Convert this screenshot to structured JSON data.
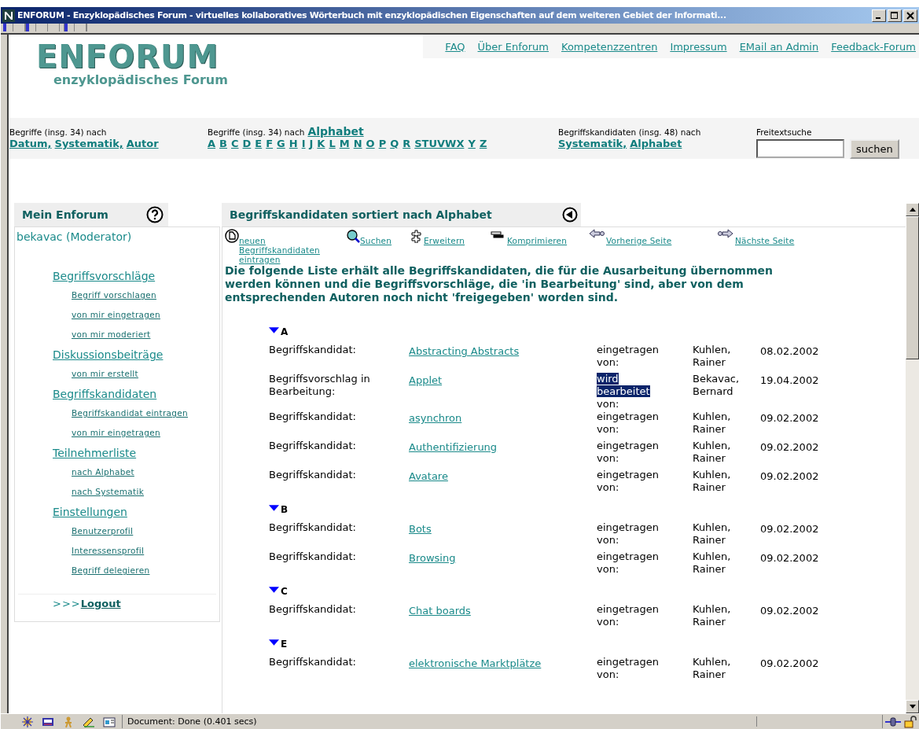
{
  "window": {
    "title": "ENFORUM - Enzyklopädisches Forum - virtuelles kollaboratives Wörterbuch mit enzyklopädischen Eigenschaften auf dem weiteren Gebiet der Informati..."
  },
  "logo": {
    "title": "ENFORUM",
    "subtitle": "enzyklopädisches Forum"
  },
  "top_links": [
    "FAQ",
    "Über Enforum",
    "Kompetenzzentren",
    "Impressum",
    "EMail an Admin",
    "Feedback-Forum"
  ],
  "nav": {
    "terms": {
      "label": "Begriffe (insg. 34)  nach",
      "links": [
        "Datum,",
        "Systematik,",
        "Autor"
      ]
    },
    "alphabet": {
      "label": "Begriffe (insg. 34)  nach",
      "title_link": "Alphabet",
      "letters": [
        "A",
        "B",
        "C",
        "D",
        "E",
        "F",
        "G",
        "H",
        "I",
        "J",
        "K",
        "L",
        "M",
        "N",
        "O",
        "P",
        "Q",
        "R",
        "STUVWX",
        "Y",
        "Z"
      ]
    },
    "candidates": {
      "label": "Begriffskandidaten (insg. 48) nach",
      "links": [
        "Systematik,",
        "Alphabet"
      ]
    },
    "search": {
      "label": "Freitextsuche",
      "button": "suchen"
    }
  },
  "sidebar": {
    "title": "Mein Enforum",
    "user": "bekavac (Moderator)",
    "sections": [
      {
        "label": "Begriffsvorschläge",
        "children": [
          "Begriff vorschlagen",
          "von mir eingetragen",
          "von mir moderiert"
        ]
      },
      {
        "label": "Diskussionsbeiträge",
        "children": [
          "von mir erstellt"
        ]
      },
      {
        "label": "Begriffskandidaten",
        "children": [
          "Begriffskandidat eintragen",
          "von mir eingetragen"
        ]
      },
      {
        "label": "Teilnehmerliste",
        "children": [
          "nach Alphabet",
          "nach Systematik"
        ]
      },
      {
        "label": "Einstellungen",
        "children": [
          "Benutzerprofil",
          "Interessensprofil",
          "Begriff delegieren"
        ]
      }
    ],
    "logout_prefix": ">>>",
    "logout": "Logout"
  },
  "main": {
    "title": "Begriffskandidaten  sortiert nach Alphabet",
    "actions": [
      {
        "kind": "new",
        "label": "neuen Begriffskandidaten eintragen"
      },
      {
        "kind": "search",
        "label": "Suchen"
      },
      {
        "kind": "expand",
        "label": "Erweitern"
      },
      {
        "kind": "collapse",
        "label": "Komprimieren"
      },
      {
        "kind": "prev",
        "label": "Vorherige Seite"
      },
      {
        "kind": "next",
        "label": "Nächste Seite"
      }
    ],
    "intro": "Die folgende Liste erhält alle Begriffskandidaten, die für die Ausarbeitung übernommen werden können und die Begriffsvorschläge, die 'in Bearbeitung' sind, aber von dem entsprechenden Autoren noch nicht 'freigegeben' worden sind.",
    "groups": [
      {
        "letter": "A",
        "expanded": true,
        "rows": [
          {
            "type": "Begriffskandidat:",
            "term": "Abstracting Abstracts",
            "status": "eingetragen",
            "status_tail": "von:",
            "highlighted": false,
            "author": "Kuhlen, Rainer",
            "date": "08.02.2002"
          },
          {
            "type": "Begriffsvorschlag in Bearbeitung:",
            "term": "Applet",
            "status": "wird bearbeitet",
            "status_tail": "von:",
            "highlighted": true,
            "author": "Bekavac, Bernard",
            "date": "19.04.2002"
          },
          {
            "type": "Begriffskandidat:",
            "term": "asynchron",
            "status": "eingetragen",
            "status_tail": "von:",
            "highlighted": false,
            "author": "Kuhlen, Rainer",
            "date": "09.02.2002"
          },
          {
            "type": "Begriffskandidat:",
            "term": "Authentifizierung",
            "status": "eingetragen",
            "status_tail": "von:",
            "highlighted": false,
            "author": "Kuhlen, Rainer",
            "date": "09.02.2002"
          },
          {
            "type": "Begriffskandidat:",
            "term": "Avatare",
            "status": "eingetragen",
            "status_tail": "von:",
            "highlighted": false,
            "author": "Kuhlen, Rainer",
            "date": "09.02.2002"
          }
        ]
      },
      {
        "letter": "B",
        "expanded": true,
        "rows": [
          {
            "type": "Begriffskandidat:",
            "term": "Bots",
            "status": "eingetragen",
            "status_tail": "von:",
            "highlighted": false,
            "author": "Kuhlen, Rainer",
            "date": "09.02.2002"
          },
          {
            "type": "Begriffskandidat:",
            "term": "Browsing",
            "status": "eingetragen",
            "status_tail": "von:",
            "highlighted": false,
            "author": "Kuhlen, Rainer",
            "date": "09.02.2002"
          }
        ]
      },
      {
        "letter": "C",
        "expanded": true,
        "rows": [
          {
            "type": "Begriffskandidat:",
            "term": "Chat boards",
            "status": "eingetragen",
            "status_tail": "von:",
            "highlighted": false,
            "author": "Kuhlen, Rainer",
            "date": "09.02.2002"
          }
        ]
      },
      {
        "letter": "E",
        "expanded": true,
        "rows": [
          {
            "type": "Begriffskandidat:",
            "term": "elektronische Marktplätze",
            "status": "eingetragen",
            "status_tail": "von:",
            "highlighted": false,
            "author": "Kuhlen, Rainer",
            "date": "09.02.2002"
          }
        ]
      }
    ]
  },
  "status_bar": {
    "text": "Document: Done (0.401 secs)"
  }
}
